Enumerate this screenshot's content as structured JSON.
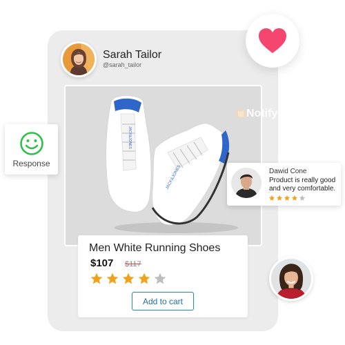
{
  "post": {
    "user_name": "Sarah Tailor",
    "user_handle": "@sarah_tailor"
  },
  "watermark": {
    "text": "NotifyVisitors"
  },
  "reaction": {
    "icon": "heart-icon",
    "color": "#f4466f"
  },
  "response": {
    "icon": "smiley-icon",
    "label": "Response",
    "color": "#2fbf4a"
  },
  "review": {
    "name": "Dawid Cone",
    "text": "Product is really good and very comfortable.",
    "rating": 4,
    "max_rating": 5
  },
  "product": {
    "title": "Men White Running Shoes",
    "price": "$107",
    "old_price": "$117",
    "rating": 4,
    "max_rating": 5,
    "cart_label": "Add to cart"
  },
  "colors": {
    "star_filled": "#f2a21a",
    "star_empty": "#bdbdbd",
    "button_border": "#1e8fa8"
  }
}
